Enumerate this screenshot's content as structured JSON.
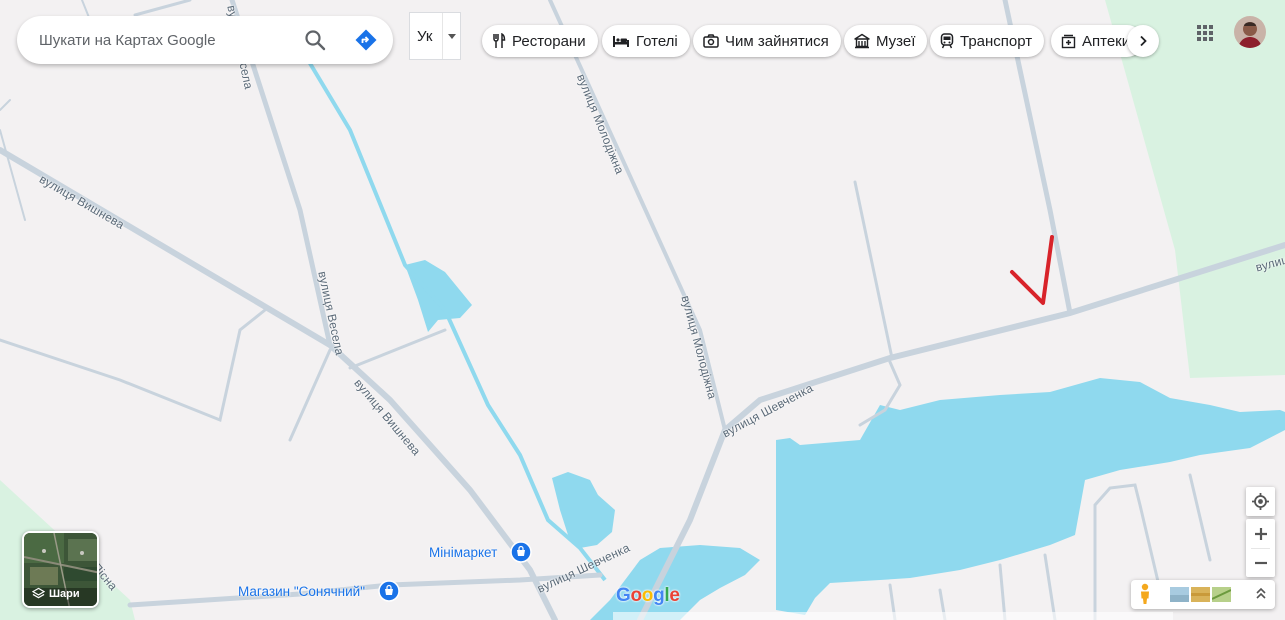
{
  "search": {
    "placeholder": "Шукати на Картах Google"
  },
  "language": {
    "label": "Ук"
  },
  "chips": [
    {
      "label": "Ресторани",
      "icon": "restaurant-icon"
    },
    {
      "label": "Готелі",
      "icon": "hotel-icon"
    },
    {
      "label": "Чим зайнятися",
      "icon": "camera-icon"
    },
    {
      "label": "Музеї",
      "icon": "museum-icon"
    },
    {
      "label": "Транспорт",
      "icon": "train-icon"
    },
    {
      "label": "Аптеки",
      "icon": "pharmacy-icon"
    }
  ],
  "streets": {
    "vyshneva_1": "вулиця Вишнева",
    "vyshneva_2": "вулиця Вишнева",
    "vesela_1": "вулиця Весела",
    "vesela_2": "вулиця Весела",
    "molodizhna_1": "вулиця Молодіжна",
    "molodizhna_2": "вулиця Молодіжна",
    "shevchenka_1": "вулиця Шевченка",
    "shevchenka_2": "вулиця Шевченка",
    "pisna": "Пісна",
    "edge_right": "вулиц"
  },
  "pois": [
    {
      "label": "Мінімаркет",
      "icon": "shopping-bag-icon"
    },
    {
      "label": "Магазин \"Сонячний\"",
      "icon": "shopping-bag-icon"
    }
  ],
  "layers": {
    "label": "Шари"
  },
  "logo": "Google",
  "colors": {
    "water": "#8fd9ee",
    "park": "#d9f2e1",
    "road": "#c8d3dd",
    "background": "#f3f1f2",
    "annotation": "#d8232a",
    "poi": "#1a73e8"
  }
}
